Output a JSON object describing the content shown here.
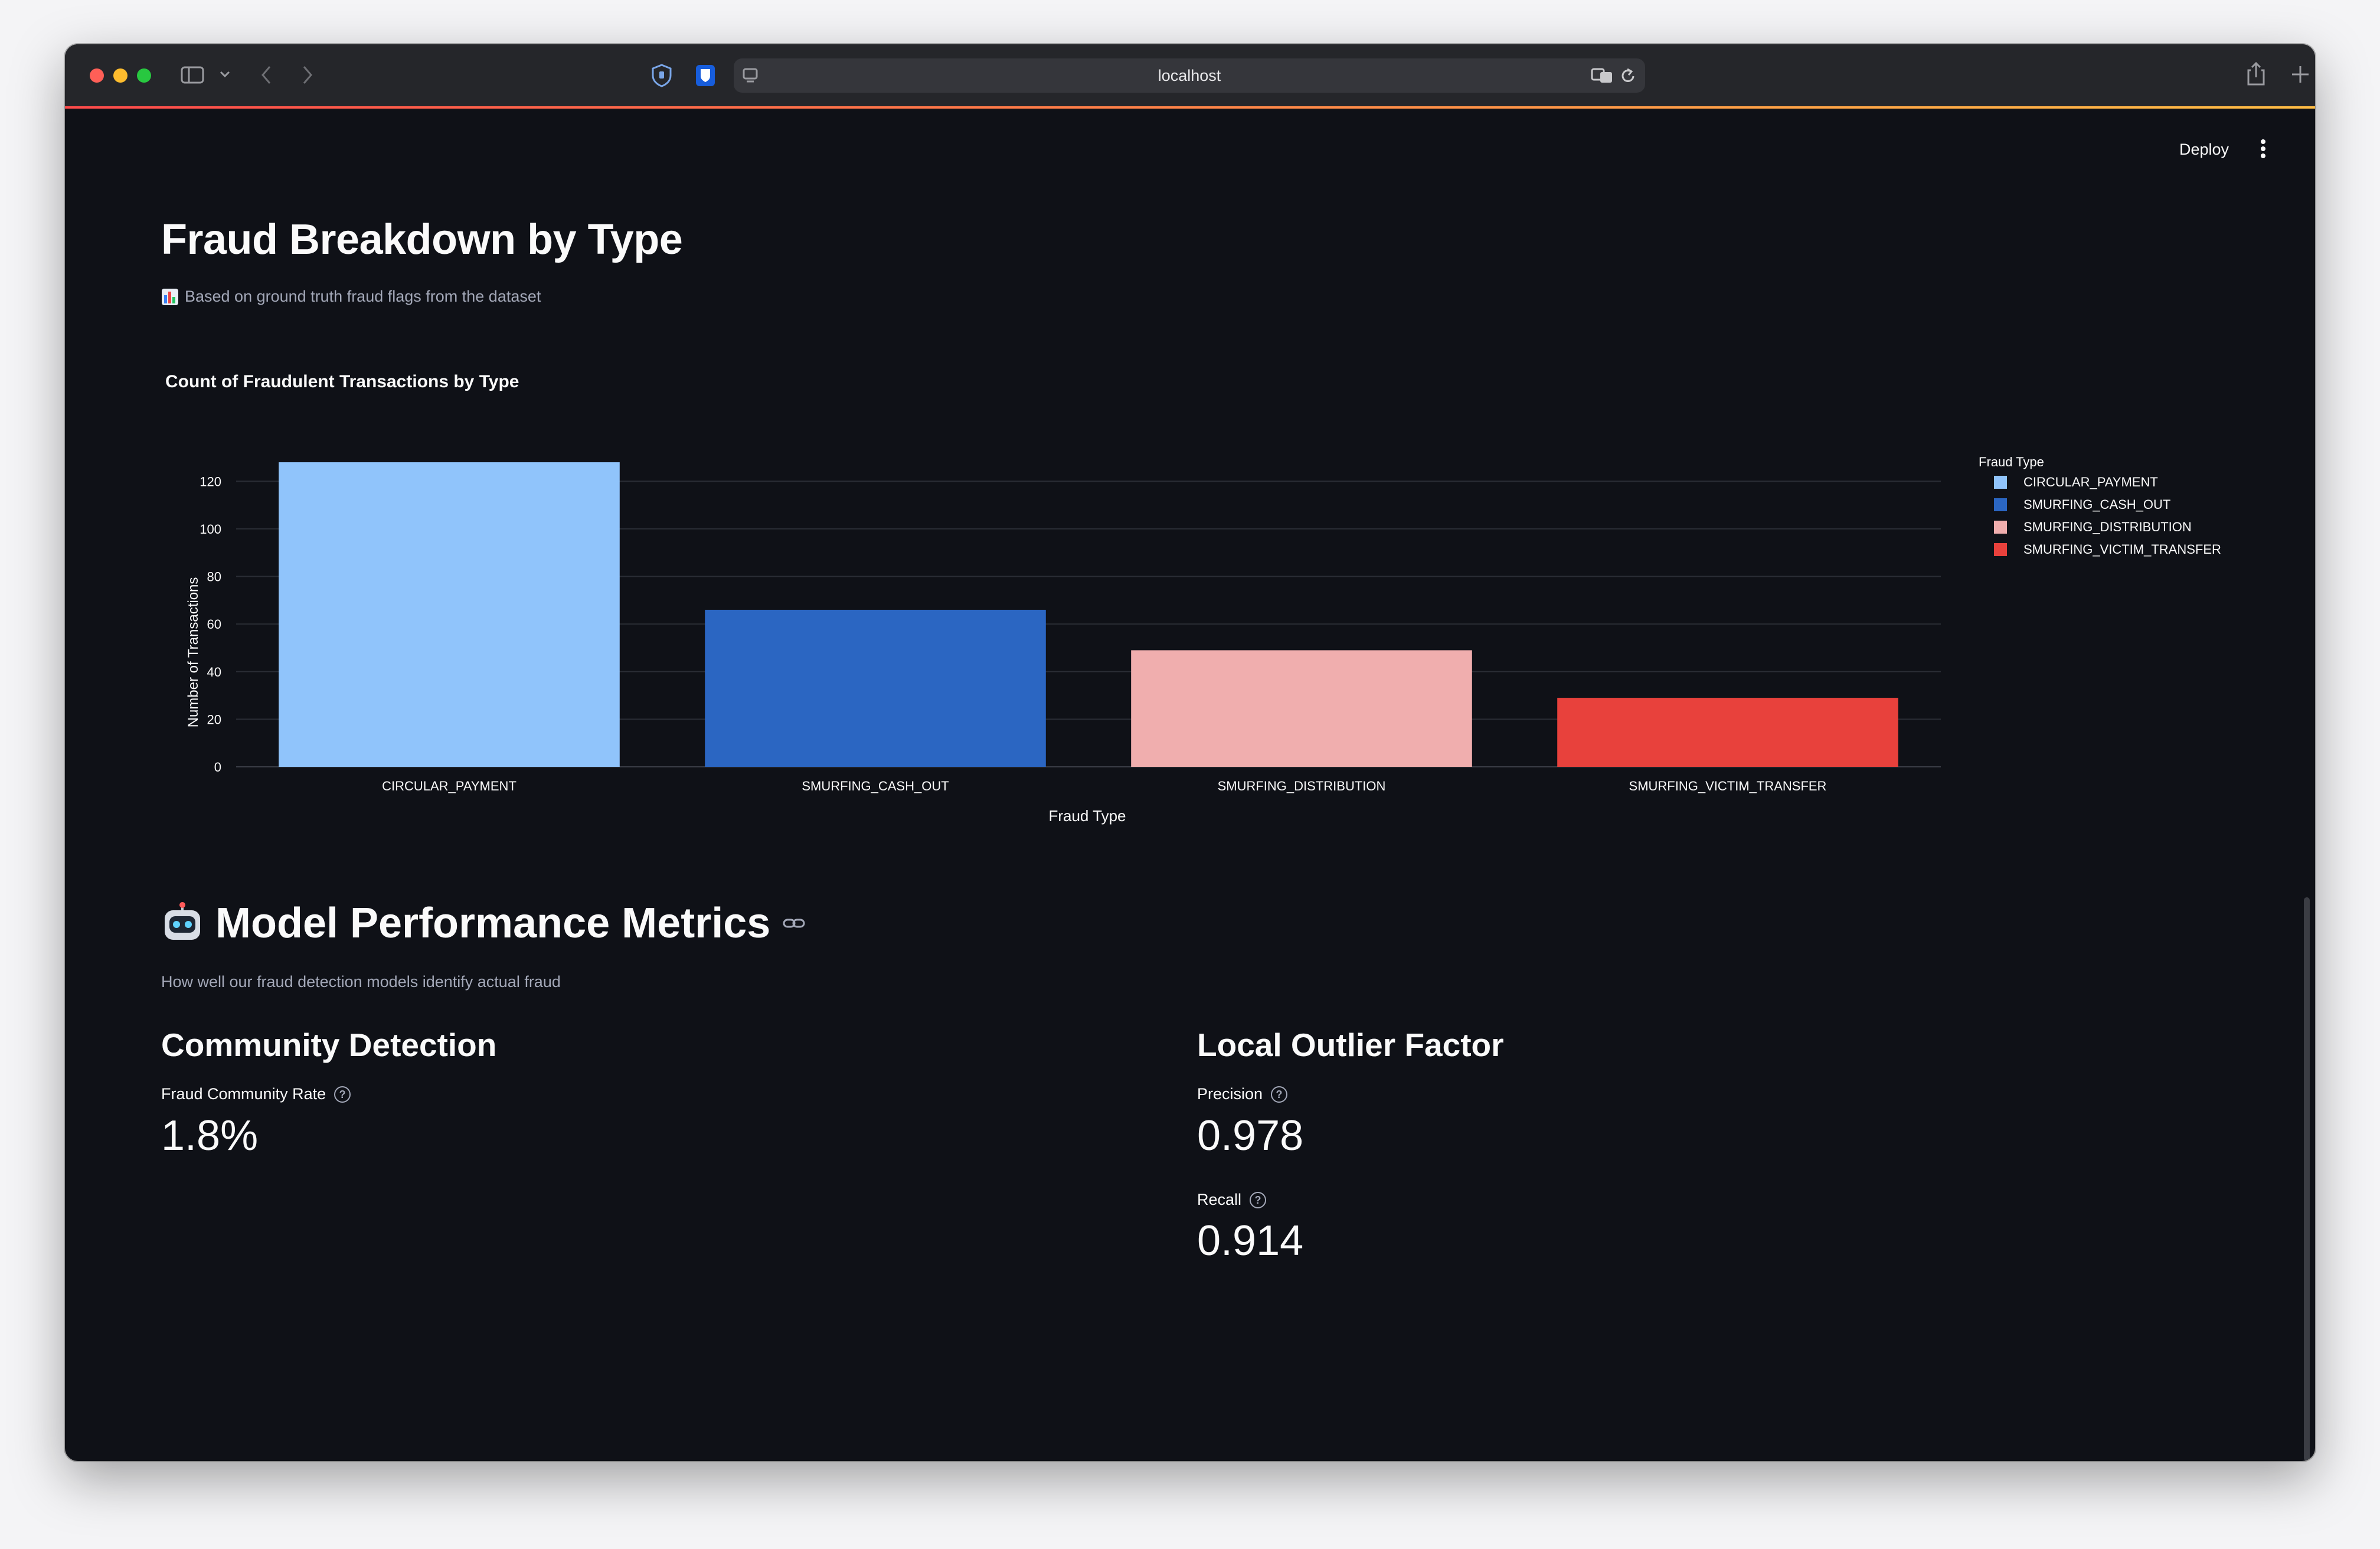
{
  "browser": {
    "url": "localhost"
  },
  "app": {
    "deploy_label": "Deploy"
  },
  "section1": {
    "title": "Fraud Breakdown by Type",
    "caption": "Based on ground truth fraud flags from the dataset",
    "caption_icon": "bar-chart-emoji"
  },
  "chart_data": {
    "type": "bar",
    "title": "Count of Fraudulent Transactions by Type",
    "categories": [
      "CIRCULAR_PAYMENT",
      "SMURFING_CASH_OUT",
      "SMURFING_DISTRIBUTION",
      "SMURFING_VICTIM_TRANSFER"
    ],
    "values": [
      128,
      66,
      49,
      29
    ],
    "colors": [
      "#90c4fb",
      "#2b66c2",
      "#f0aeae",
      "#e8413c"
    ],
    "xlabel": "Fraud Type",
    "ylabel": "Number of Transactions",
    "ylim": [
      0,
      130
    ],
    "yticks": [
      0,
      20,
      40,
      60,
      80,
      100,
      120
    ],
    "grid": true,
    "legend_title": "Fraud Type",
    "legend_position": "top-right"
  },
  "section2": {
    "icon": "robot-emoji",
    "title": "Model Performance Metrics",
    "subtitle": "How well our fraud detection models identify actual fraud"
  },
  "community": {
    "title": "Community Detection",
    "metrics": [
      {
        "label": "Fraud Community Rate",
        "value": "1.8%"
      }
    ]
  },
  "lof": {
    "title": "Local Outlier Factor",
    "metrics": [
      {
        "label": "Precision",
        "value": "0.978"
      },
      {
        "label": "Recall",
        "value": "0.914"
      }
    ]
  }
}
